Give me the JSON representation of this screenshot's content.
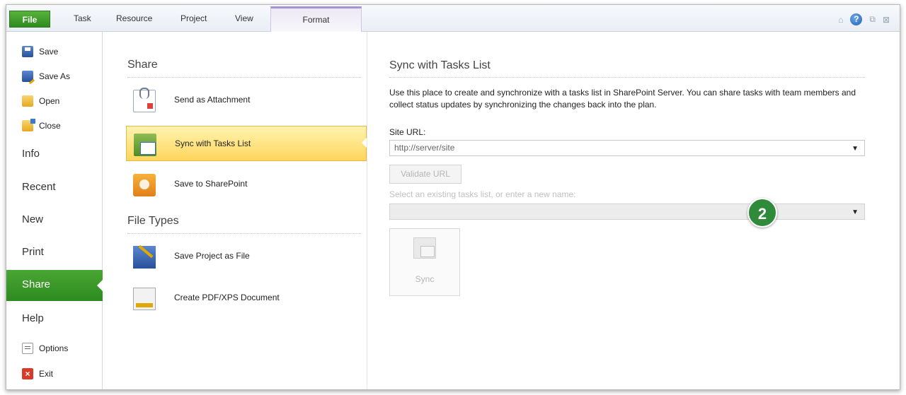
{
  "ribbon": {
    "tabs": [
      "File",
      "Task",
      "Resource",
      "Project",
      "View",
      "Format"
    ],
    "controls": {
      "minimize_ribbon": "⌂",
      "help": "?",
      "restore": "⧉",
      "close": "⊠"
    }
  },
  "nav": {
    "small_items": [
      {
        "label": "Save",
        "icon": "save-icon"
      },
      {
        "label": "Save As",
        "icon": "save-as-icon"
      },
      {
        "label": "Open",
        "icon": "open-folder-icon"
      },
      {
        "label": "Close",
        "icon": "close-folder-icon"
      }
    ],
    "big_items": [
      "Info",
      "Recent",
      "New",
      "Print",
      "Share",
      "Help"
    ],
    "bottom_items": [
      {
        "label": "Options",
        "icon": "options-icon"
      },
      {
        "label": "Exit",
        "icon": "exit-icon"
      }
    ],
    "selected": "Share",
    "accent_color": "#3a9a2a"
  },
  "middle": {
    "share_title": "Share",
    "share_options": [
      {
        "label": "Send as Attachment",
        "icon": "attachment-icon"
      },
      {
        "label": "Sync with Tasks List",
        "icon": "sync-tasks-icon",
        "selected": true
      },
      {
        "label": "Save to SharePoint",
        "icon": "sharepoint-icon"
      }
    ],
    "file_types_title": "File Types",
    "file_type_options": [
      {
        "label": "Save Project as File",
        "icon": "project-file-icon"
      },
      {
        "label": "Create PDF/XPS Document",
        "icon": "pdf-xps-icon"
      }
    ]
  },
  "right": {
    "title": "Sync with Tasks List",
    "description": "Use this place to create and synchronize with a tasks list in SharePoint Server. You can share tasks with team members and collect status updates by synchronizing the changes back into the plan.",
    "site_url_label": "Site URL:",
    "site_url_value": "http://server/site",
    "validate_button": "Validate URL",
    "tasks_list_hint": "Select an existing tasks list, or enter a new name:",
    "tasks_list_value": "",
    "sync_button": "Sync",
    "callout_badge": "2",
    "badge_color": "#2f8a3a"
  }
}
